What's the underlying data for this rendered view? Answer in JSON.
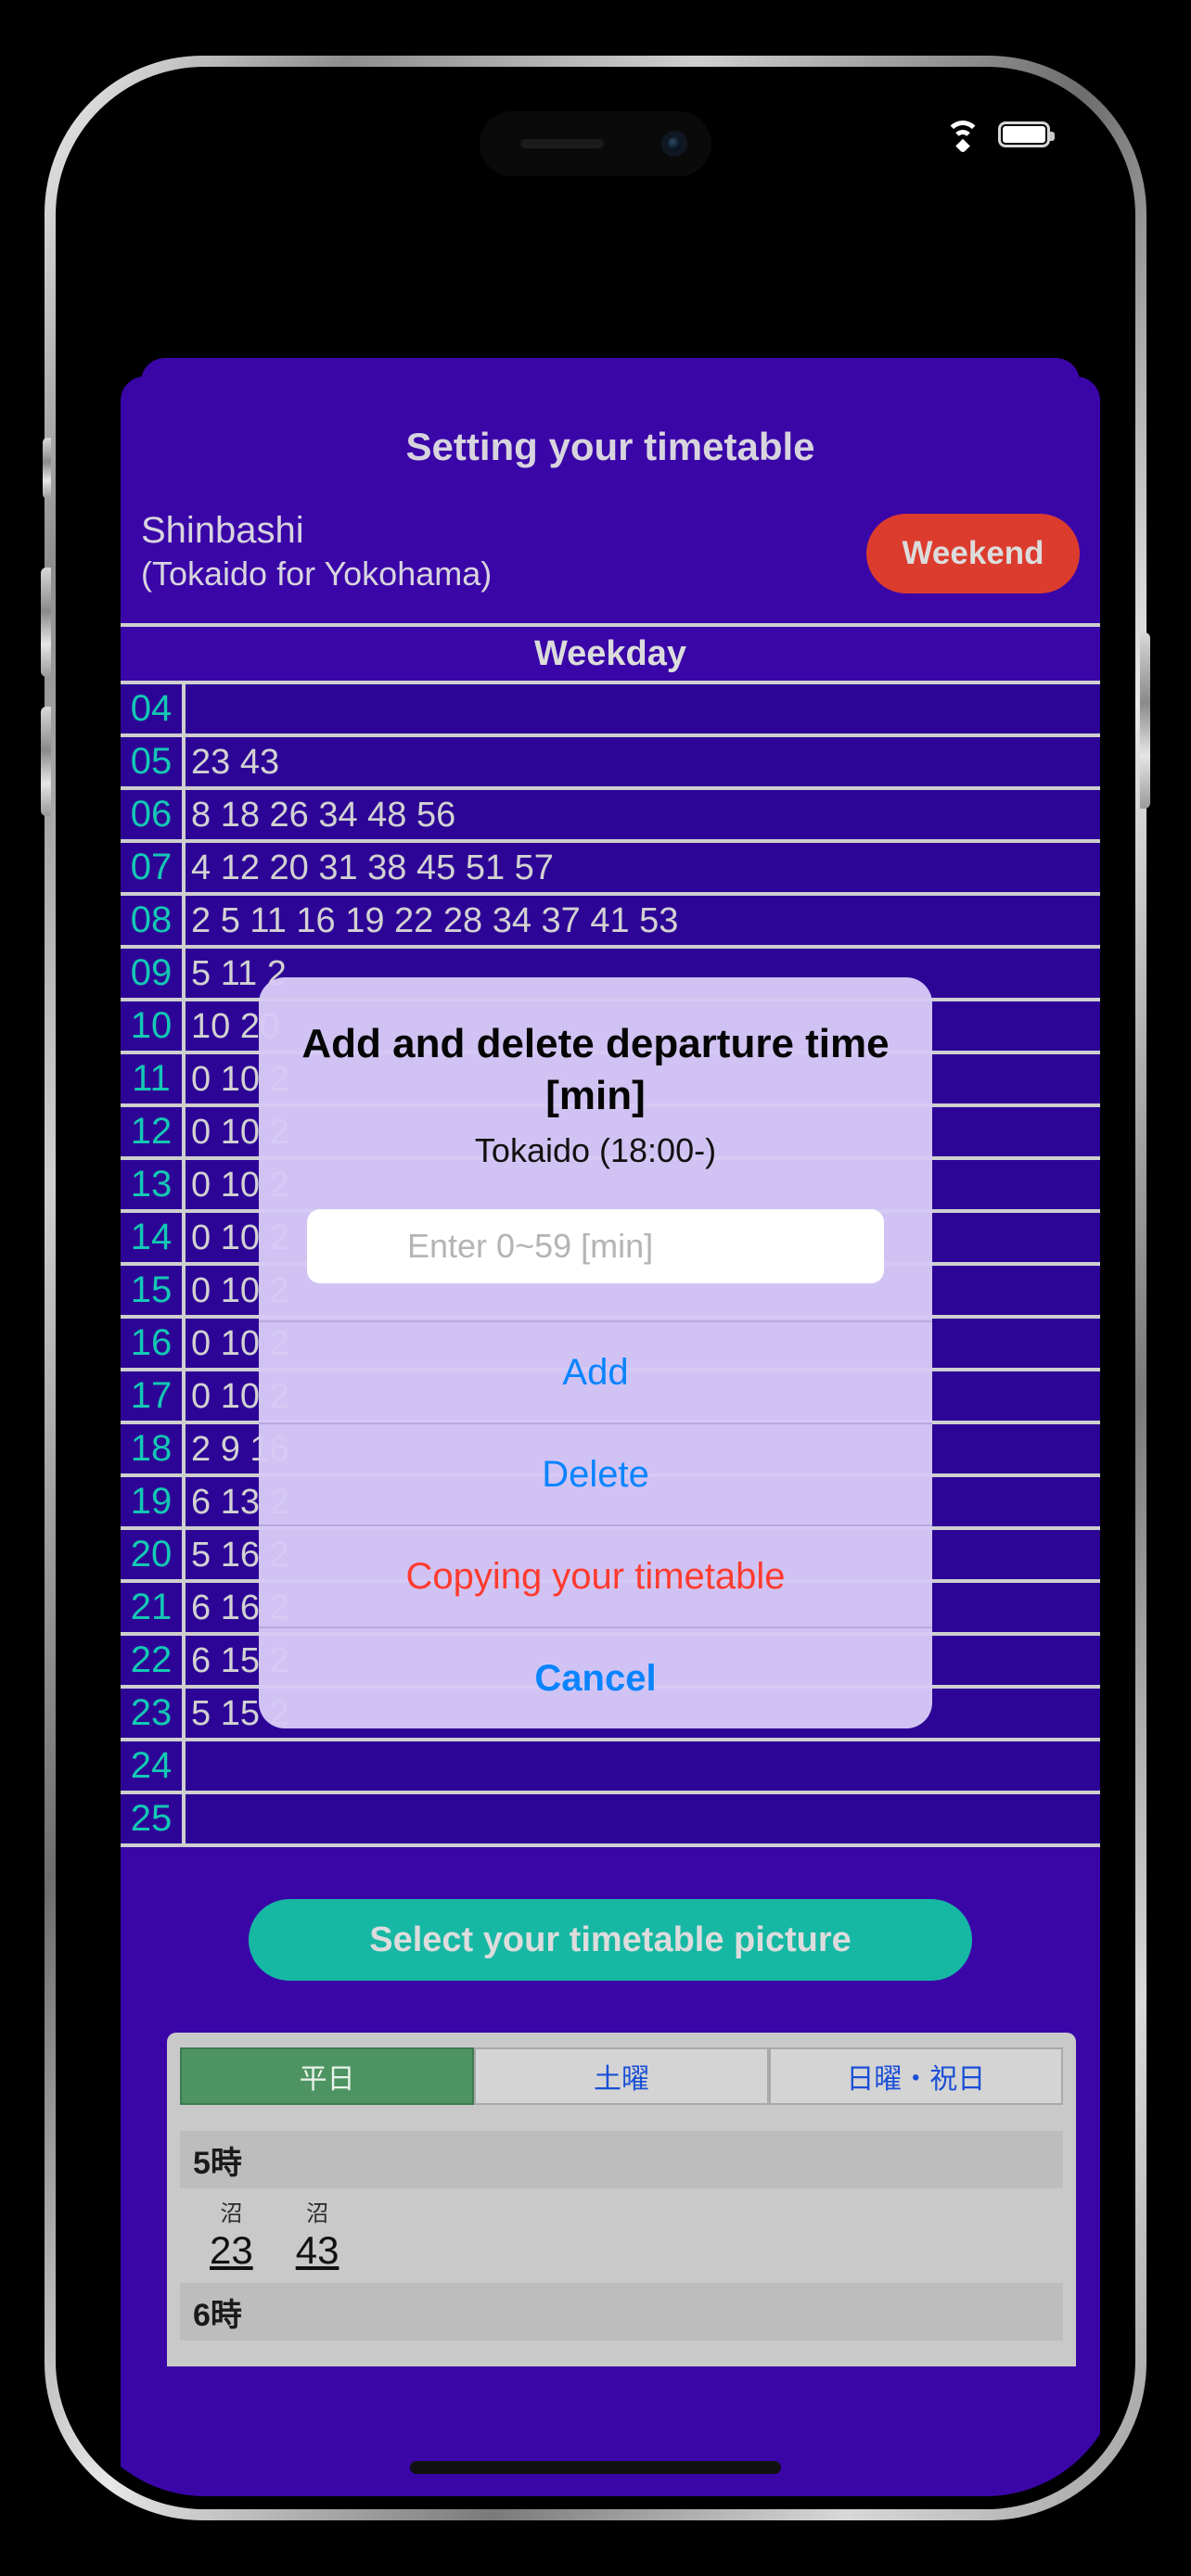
{
  "status_bar": {
    "wifi_icon": "wifi-icon",
    "battery_icon": "battery-full-icon"
  },
  "header": {
    "title": "Setting your timetable",
    "station_name": "Shinbashi",
    "station_line": "(Tokaido for Yokohama)",
    "weekend_button": "Weekend"
  },
  "timetable": {
    "column_header": "Weekday",
    "rows": [
      {
        "hour": "04",
        "minutes": ""
      },
      {
        "hour": "05",
        "minutes": "23 43"
      },
      {
        "hour": "06",
        "minutes": "8 18 26 34 48 56"
      },
      {
        "hour": "07",
        "minutes": "4 12 20 31 38 45 51 57"
      },
      {
        "hour": "08",
        "minutes": "2 5 11 16 19 22 28 34 37 41 53"
      },
      {
        "hour": "09",
        "minutes": "5 11 2"
      },
      {
        "hour": "10",
        "minutes": "10 20"
      },
      {
        "hour": "11",
        "minutes": "0 10 2"
      },
      {
        "hour": "12",
        "minutes": "0 10 2"
      },
      {
        "hour": "13",
        "minutes": "0 10 2"
      },
      {
        "hour": "14",
        "minutes": "0 10 2"
      },
      {
        "hour": "15",
        "minutes": "0 10 2"
      },
      {
        "hour": "16",
        "minutes": "0 10 2"
      },
      {
        "hour": "17",
        "minutes": "0 10 2"
      },
      {
        "hour": "18",
        "minutes": "2 9 16"
      },
      {
        "hour": "19",
        "minutes": "6 13 2"
      },
      {
        "hour": "20",
        "minutes": "5 16 2"
      },
      {
        "hour": "21",
        "minutes": "6 16 2"
      },
      {
        "hour": "22",
        "minutes": "6 15 2"
      },
      {
        "hour": "23",
        "minutes": "5 15 2"
      },
      {
        "hour": "24",
        "minutes": ""
      },
      {
        "hour": "25",
        "minutes": ""
      }
    ]
  },
  "picture_button": {
    "label": "Select your timetable picture"
  },
  "preview": {
    "tabs": [
      {
        "label": "平日",
        "active": true
      },
      {
        "label": "土曜",
        "active": false
      },
      {
        "label": "日曜・祝日",
        "active": false
      }
    ],
    "hour_label_1": "5時",
    "hour_label_2": "6時",
    "times": [
      {
        "destination": "沼",
        "minute": "23"
      },
      {
        "destination": "沼",
        "minute": "43"
      }
    ]
  },
  "dialog": {
    "title": "Add and delete departure time [min]",
    "subtitle": "Tokaido (18:00-)",
    "input_value": "",
    "input_placeholder": "Enter 0~59 [min]",
    "buttons": [
      {
        "label": "Add",
        "style": "default"
      },
      {
        "label": "Delete",
        "style": "default"
      },
      {
        "label": "Copying your timetable",
        "style": "destructive"
      },
      {
        "label": "Cancel",
        "style": "cancel"
      }
    ]
  },
  "colors": {
    "app_background": "#3a06a8",
    "table_row": "#2d0596",
    "hour_text": "#14c8b4",
    "weekend_button": "#dc3c2e",
    "picture_button": "#16b8a4",
    "dialog_background": "#d6c9f6",
    "dialog_action": "#0a84ff",
    "dialog_destructive": "#ff3b2f",
    "preview_tab_active": "#4e9462"
  }
}
